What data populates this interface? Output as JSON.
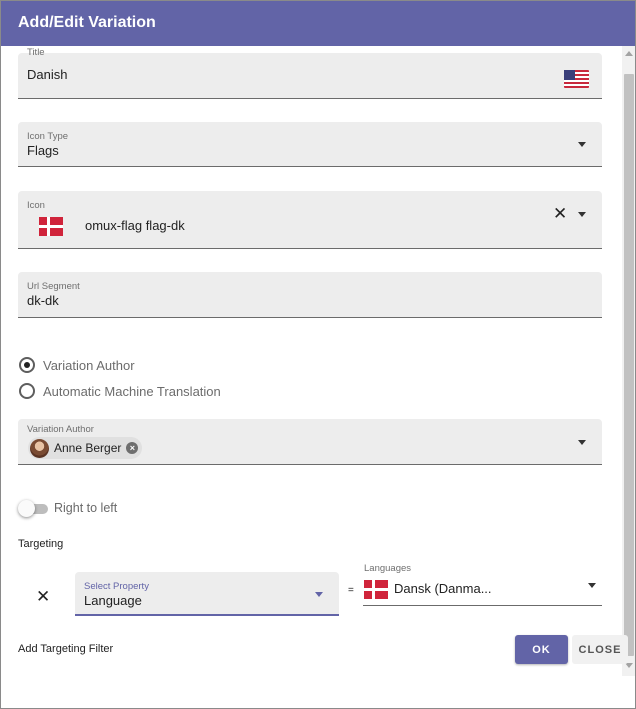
{
  "dialog": {
    "title": "Add/Edit Variation"
  },
  "form": {
    "title_field": {
      "label": "Title",
      "value": "Danish",
      "flag_icon": "us-flag-icon"
    },
    "icon_type": {
      "label": "Icon Type",
      "value": "Flags"
    },
    "icon": {
      "label": "Icon",
      "value": "omux-flag flag-dk",
      "flag_icon": "dk-flag-icon"
    },
    "url_segment": {
      "label": "Url Segment",
      "value": "dk-dk"
    },
    "radio_options": [
      {
        "label": "Variation Author",
        "selected": true
      },
      {
        "label": "Automatic Machine Translation",
        "selected": false
      }
    ],
    "variation_author": {
      "label": "Variation Author",
      "chip_label": "Anne Berger"
    },
    "rtl_toggle": {
      "label": "Right to left",
      "on": false
    },
    "targeting": {
      "section_label": "Targeting",
      "select_property": {
        "label": "Select Property",
        "value": "Language"
      },
      "operator": "=",
      "languages": {
        "label": "Languages",
        "value": "Dansk (Danma..."
      },
      "add_filter_label": "Add Targeting Filter"
    }
  },
  "footer": {
    "ok_label": "OK",
    "close_label": "CLOSE"
  },
  "colors": {
    "accent": "#6264a7",
    "field_bg": "#ededed",
    "flag_red": "#d0243b"
  }
}
